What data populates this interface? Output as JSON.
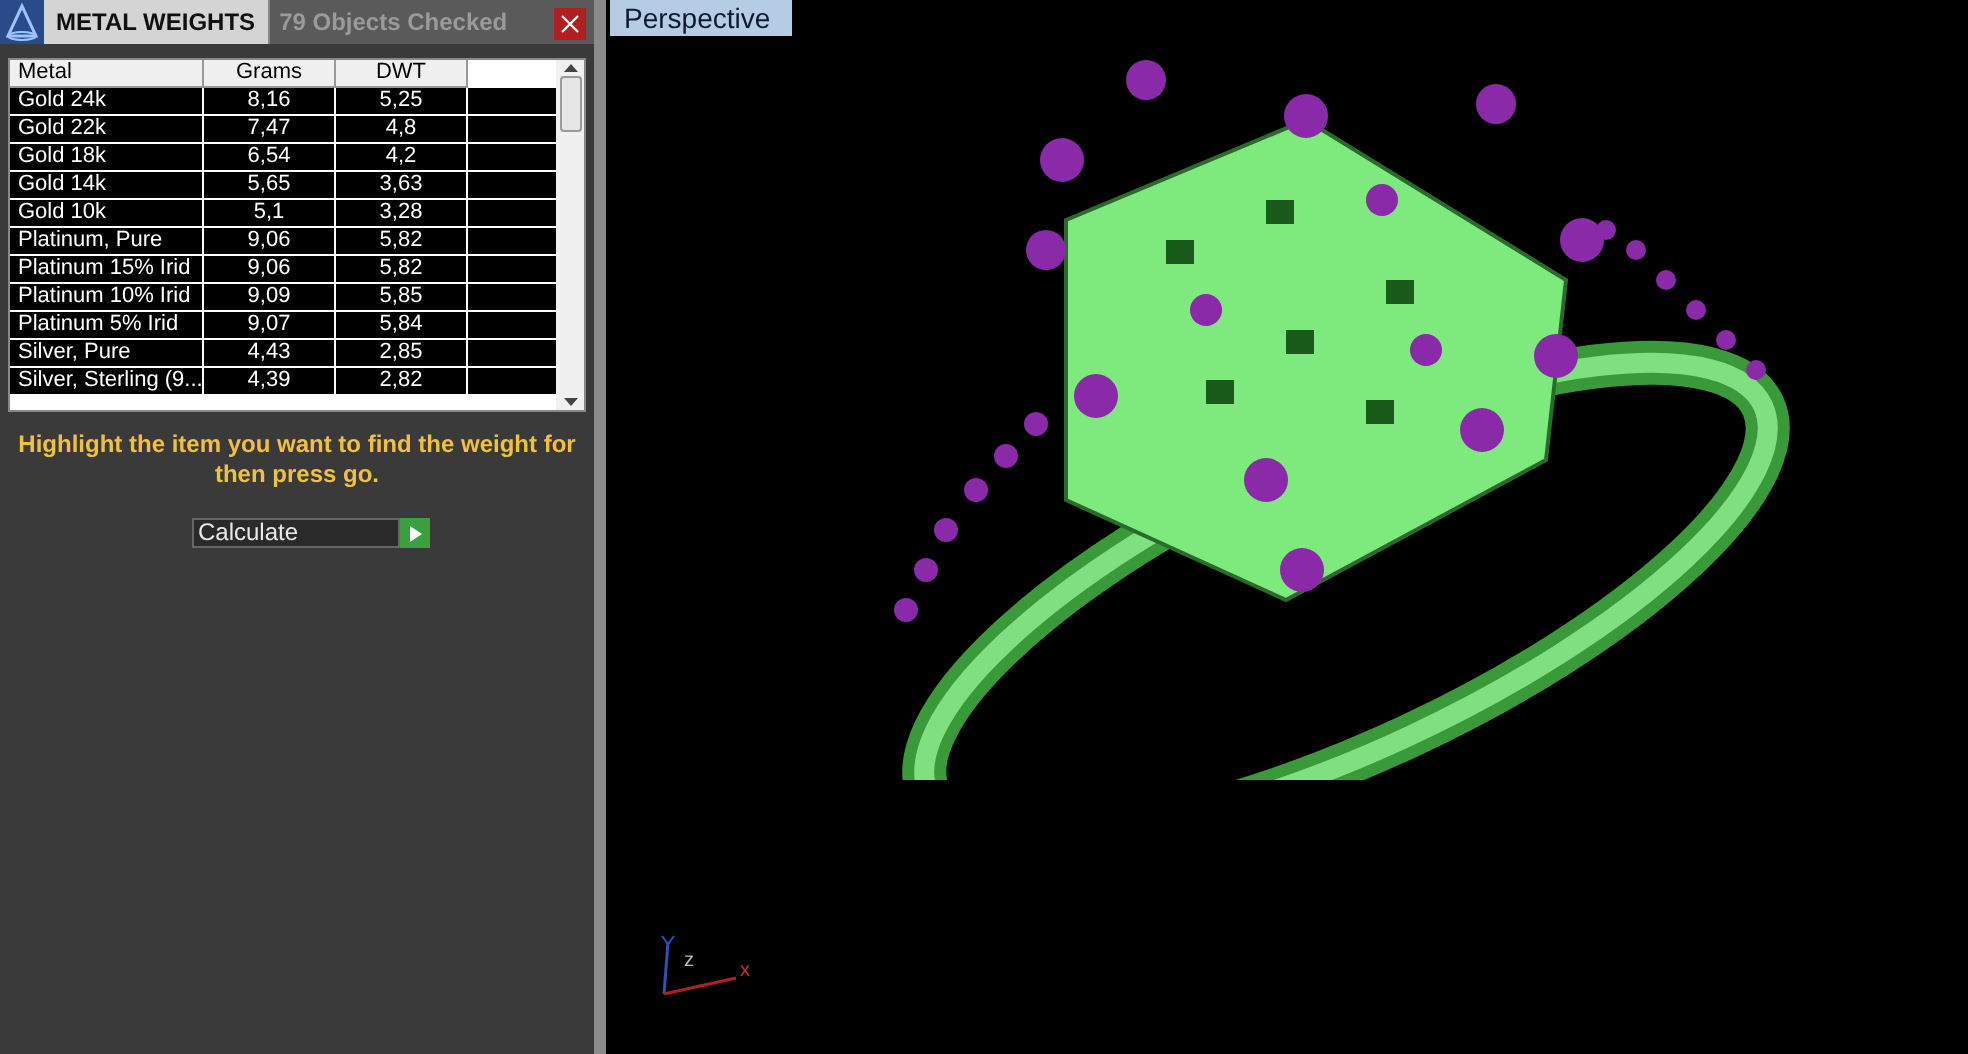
{
  "panel": {
    "tabs": [
      {
        "label": "METAL WEIGHTS",
        "selected": true
      },
      {
        "label": "79 Objects Checked",
        "selected": false
      }
    ],
    "table": {
      "columns": [
        "Metal",
        "Grams",
        "DWT"
      ],
      "rows": [
        {
          "cells": [
            "Gold 24k",
            "8,16",
            "5,25"
          ]
        },
        {
          "cells": [
            "Gold 22k",
            "7,47",
            "4,8"
          ]
        },
        {
          "cells": [
            "Gold 18k",
            "6,54",
            "4,2"
          ]
        },
        {
          "cells": [
            "Gold 14k",
            "5,65",
            "3,63"
          ]
        },
        {
          "cells": [
            "Gold 10k",
            "5,1",
            "3,28"
          ]
        },
        {
          "cells": [
            "Platinum, Pure",
            "9,06",
            "5,82"
          ]
        },
        {
          "cells": [
            "Platinum 15% Irid",
            "9,06",
            "5,82"
          ]
        },
        {
          "cells": [
            "Platinum 10% Irid",
            "9,09",
            "5,85"
          ]
        },
        {
          "cells": [
            "Platinum 5% Irid",
            "9,07",
            "5,84"
          ]
        },
        {
          "cells": [
            "Silver, Pure",
            "4,43",
            "2,85"
          ]
        },
        {
          "cells": [
            "Silver, Sterling (9...",
            "4,39",
            "2,82"
          ]
        }
      ]
    },
    "instruction": "Highlight the item you want to find the weight for then press go.",
    "dropdown": {
      "value": "Calculate"
    }
  },
  "viewport": {
    "label": "Perspective",
    "axes": [
      "z",
      "x"
    ]
  }
}
